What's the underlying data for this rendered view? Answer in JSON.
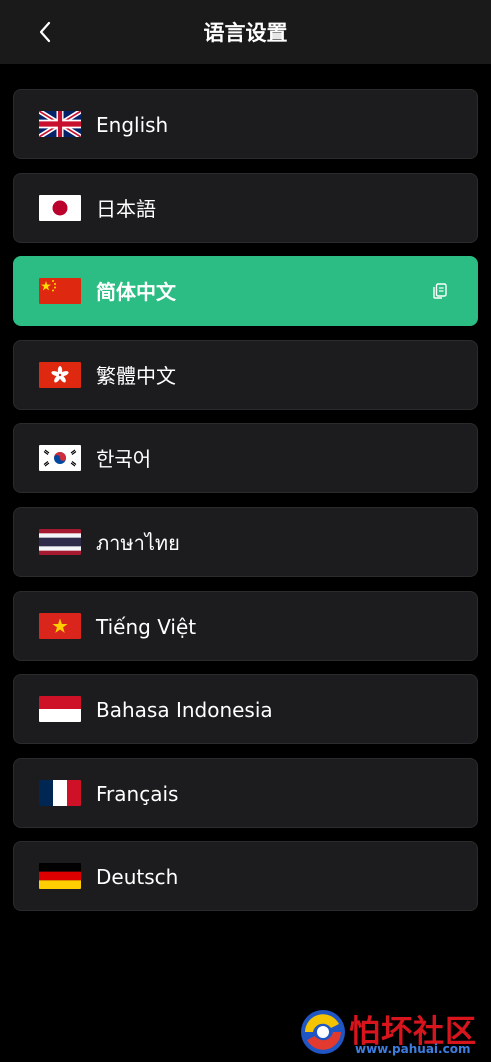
{
  "header": {
    "title": "语言设置",
    "back_icon": "chevron-left-icon"
  },
  "languages": [
    {
      "label": "English",
      "flag": "uk-flag-icon",
      "selected": false
    },
    {
      "label": "日本語",
      "flag": "japan-flag-icon",
      "selected": false
    },
    {
      "label": "简体中文",
      "flag": "china-flag-icon",
      "selected": true
    },
    {
      "label": "繁體中文",
      "flag": "hong-kong-flag-icon",
      "selected": false
    },
    {
      "label": "한국어",
      "flag": "korea-flag-icon",
      "selected": false
    },
    {
      "label": "ภาษาไทย",
      "flag": "thailand-flag-icon",
      "selected": false
    },
    {
      "label": "Tiếng Việt",
      "flag": "vietnam-flag-icon",
      "selected": false
    },
    {
      "label": "Bahasa Indonesia",
      "flag": "indonesia-flag-icon",
      "selected": false
    },
    {
      "label": "Français",
      "flag": "france-flag-icon",
      "selected": false
    },
    {
      "label": "Deutsch",
      "flag": "germany-flag-icon",
      "selected": false
    }
  ],
  "selected_icon": "selected-check-icon",
  "colors": {
    "background": "#000000",
    "header": "#1a1a1a",
    "card": "#1c1c1e",
    "accent": "#2bbd83",
    "watermark_red": "#d8141d",
    "watermark_blue": "#3d7de0"
  },
  "watermark": {
    "text": "怕坏社区",
    "url": "www.pahuai.com"
  }
}
